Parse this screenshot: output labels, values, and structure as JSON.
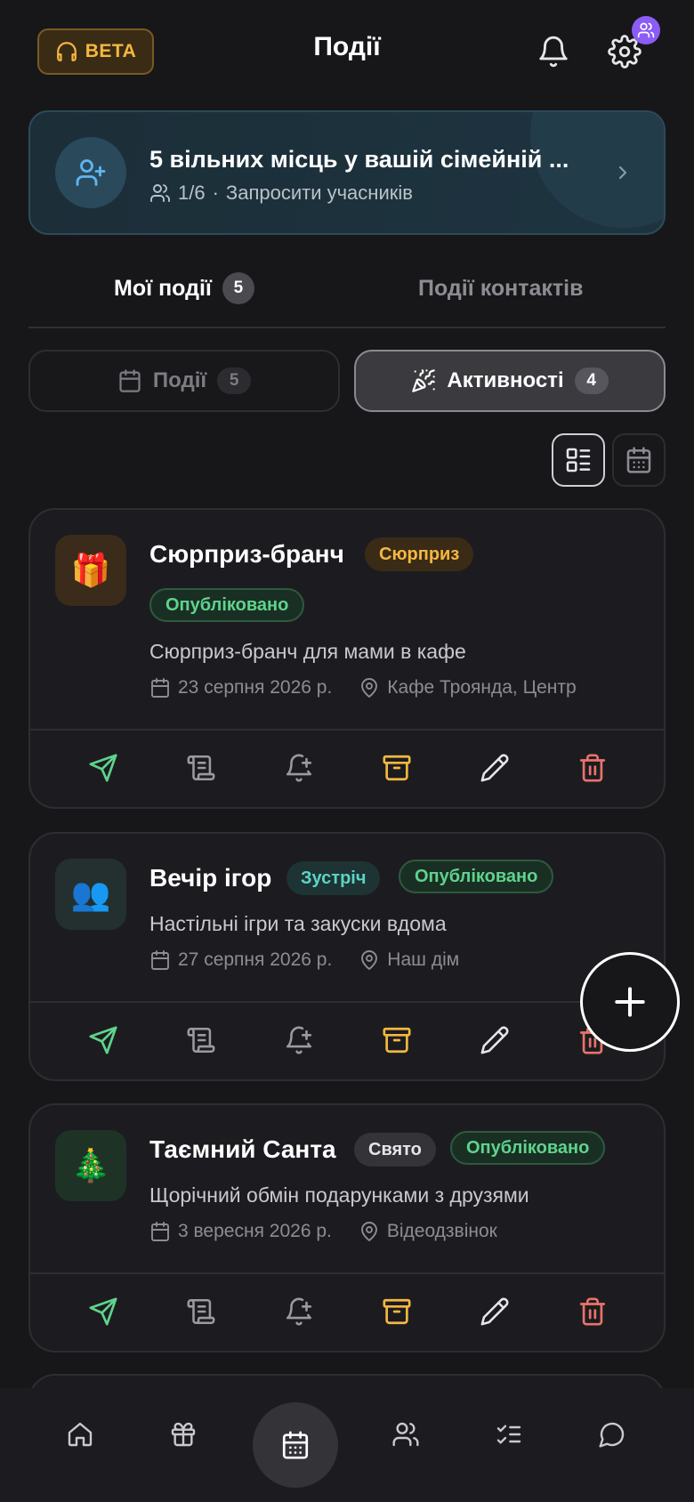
{
  "header": {
    "beta_label": "BETA",
    "title": "Події",
    "icons": [
      "headset-icon",
      "bell-icon",
      "gear-icon",
      "users-icon"
    ]
  },
  "banner": {
    "title": "5 вільних місць у вашій сімейній ...",
    "members": "1/6",
    "separator": "·",
    "invite_label": "Запросити учасників"
  },
  "tabs": [
    {
      "label": "Мої події",
      "count": "5",
      "active": true
    },
    {
      "label": "Події контактів",
      "active": false
    }
  ],
  "segments": [
    {
      "label": "Події",
      "count": "5",
      "active": false
    },
    {
      "label": "Активності",
      "count": "4",
      "active": true
    }
  ],
  "view_toggle": {
    "active": "list",
    "options": [
      "list",
      "calendar"
    ]
  },
  "cards": [
    {
      "emoji": "🎁",
      "title": "Сюрприз-бранч",
      "type_tag": "Сюрприз",
      "status_tag": "Опубліковано",
      "description": "Сюрприз-бранч для мами в кафе",
      "date": "23 серпня 2026 р.",
      "location": "Кафе Троянда, Центр"
    },
    {
      "emoji": "👥",
      "title": "Вечір ігор",
      "type_tag": "Зустріч",
      "status_tag": "Опубліковано",
      "description": "Настільні ігри та закуски вдома",
      "date": "27 серпня 2026 р.",
      "location": "Наш дім"
    },
    {
      "emoji": "🎄",
      "title": "Таємний Санта",
      "type_tag": "Свято",
      "status_tag": "Опубліковано",
      "description": "Щорічний обмін подарунками з друзями",
      "date": "3 вересня 2026 р.",
      "location": "Відеодзвінок"
    }
  ],
  "colors": {
    "background": "#17171a",
    "card": "#1c1c20",
    "accent_amber": "#f5b740",
    "accent_green": "#5fd38d",
    "accent_red": "#e8736a",
    "accent_purple": "#8b5cf6"
  },
  "bottom_nav": [
    {
      "icon": "home-icon",
      "active": false
    },
    {
      "icon": "gift-icon",
      "active": false
    },
    {
      "icon": "calendar-icon",
      "active": true
    },
    {
      "icon": "users-icon",
      "active": false
    },
    {
      "icon": "checklist-icon",
      "active": false
    },
    {
      "icon": "chat-icon",
      "active": false
    }
  ]
}
